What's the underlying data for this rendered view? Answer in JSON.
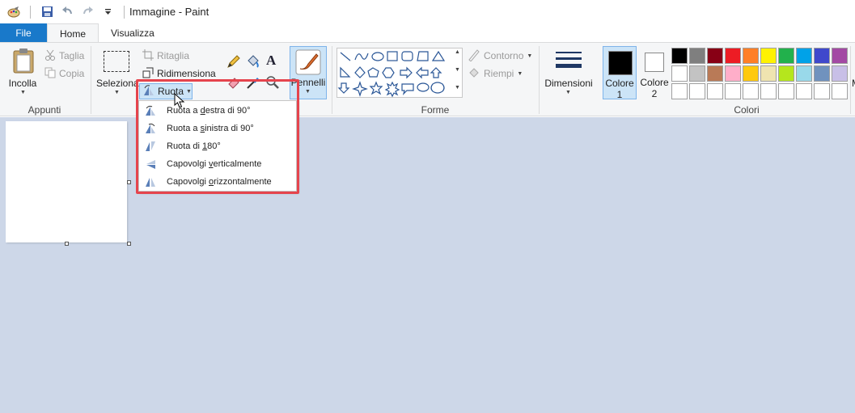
{
  "window": {
    "title": "Immagine - Paint"
  },
  "tabs": {
    "file": "File",
    "home": "Home",
    "view": "Visualizza"
  },
  "clipboard": {
    "paste": "Incolla",
    "cut": "Taglia",
    "copy": "Copia",
    "group": "Appunti"
  },
  "image": {
    "select": "Seleziona",
    "crop": "Ritaglia",
    "resize": "Ridimensiona",
    "rotate": "Ruota"
  },
  "brushes": {
    "label": "Pennelli"
  },
  "shapes": {
    "outline": "Contorno",
    "fill": "Riempi",
    "group": "Forme"
  },
  "size": {
    "label": "Dimensioni"
  },
  "colors": {
    "color1": "Colore",
    "color1_num": "1",
    "color2": "Colore",
    "color2_num": "2",
    "group": "Colori",
    "more": "M",
    "palette_row1": [
      "#000000",
      "#7f7f7f",
      "#880015",
      "#ed1c24",
      "#ff7f27",
      "#fff200",
      "#22b14c",
      "#00a2e8",
      "#3f48cc",
      "#a349a4"
    ],
    "palette_row2": [
      "#ffffff",
      "#c3c3c3",
      "#b97a57",
      "#ffaec9",
      "#ffc90e",
      "#efe4b0",
      "#b5e61d",
      "#99d9ea",
      "#7092be",
      "#c8bfe7"
    ]
  },
  "rotate_menu": {
    "item1_pre": "Ruota a ",
    "item1_key": "d",
    "item1_post": "estra di 90°",
    "item2_pre": "Ruota a ",
    "item2_key": "s",
    "item2_post": "inistra di 90°",
    "item3_pre": "Ruota di ",
    "item3_key": "1",
    "item3_post": "80°",
    "item4_pre": "Capovolgi ",
    "item4_key": "v",
    "item4_post": "erticalmente",
    "item5_pre": "Capovolgi ",
    "item5_key": "o",
    "item5_post": "rizzontalmente"
  }
}
